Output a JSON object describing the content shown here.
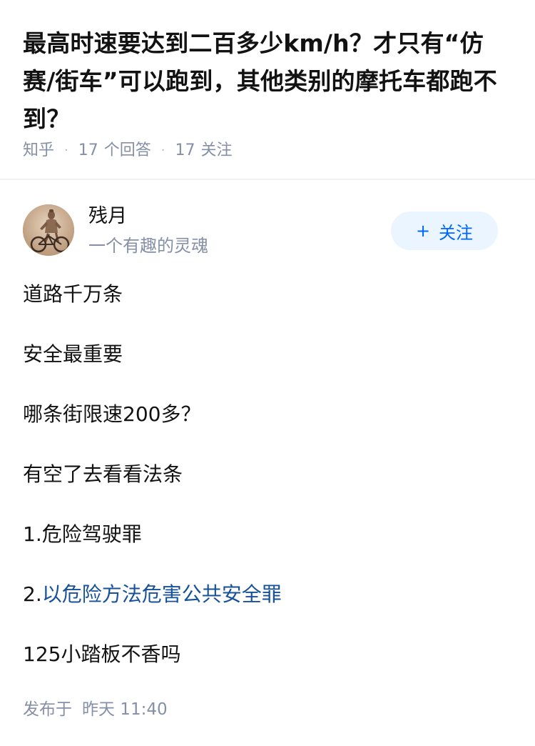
{
  "question": {
    "title": "最高时速要达到二百多少km/h？才只有“仿赛/街车”可以跑到，其他类别的摩托车都跑不到？",
    "source": "知乎",
    "answer_count": "17",
    "answer_label": "个回答",
    "follow_count": "17",
    "follow_label": "关注"
  },
  "author": {
    "name": "残月",
    "bio": "一个有趣的灵魂",
    "avatar_icon": "terracotta-warrior-on-bicycle-avatar",
    "follow_button_label": "关注",
    "follow_button_icon": "plus-icon"
  },
  "answer": {
    "paragraphs": [
      {
        "text": "道路千万条"
      },
      {
        "text": "安全最重要"
      },
      {
        "text": "哪条街限速200多？"
      },
      {
        "text": "有空了去看看法条"
      },
      {
        "text": "1.危险驾驶罪"
      },
      {
        "prefix": "2.",
        "link": "以危险方法危害公共安全罪"
      },
      {
        "text": "125小踏板不香吗"
      }
    ]
  },
  "publish": {
    "label": "发布于",
    "time": "昨天 11:40"
  },
  "colors": {
    "link": "#175199",
    "accent": "#0066ff",
    "follow_bg": "#ebf5ff",
    "meta_gray": "#8590a6",
    "text": "#121212"
  }
}
